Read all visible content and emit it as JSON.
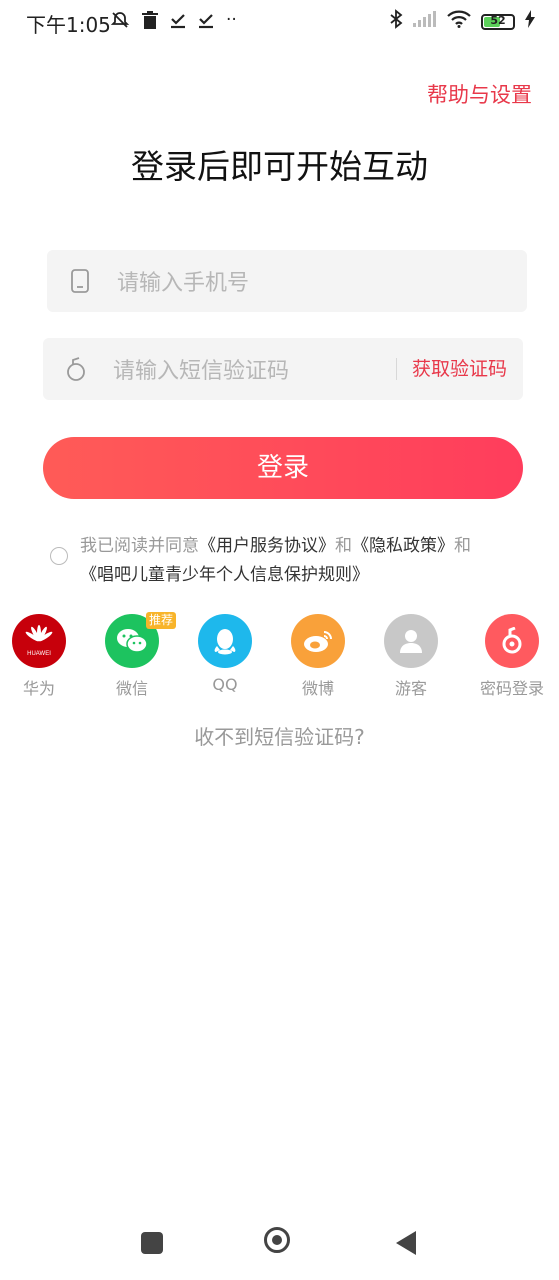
{
  "status_bar": {
    "time": "下午1:05",
    "battery_level": "52",
    "dots": "··"
  },
  "header": {
    "help_settings": "帮助与设置",
    "title": "登录后即可开始互动"
  },
  "form": {
    "phone_placeholder": "请输入手机号",
    "code_placeholder": "请输入短信验证码",
    "get_code": "获取验证码",
    "login": "登录"
  },
  "agreement": {
    "prefix": "我已阅读并同意",
    "terms": "《用户服务协议》",
    "and1": "和",
    "privacy": "《隐私政策》",
    "and2": "和",
    "minors": "《唱吧儿童青少年个人信息保护规则》"
  },
  "socials": {
    "huawei": {
      "label": "华为",
      "logo_text": "HUAWEI",
      "color": "#c7000b"
    },
    "wechat": {
      "label": "微信",
      "badge": "推荐",
      "color": "#1dc35f"
    },
    "qq": {
      "label": "QQ",
      "color": "#1eb8ec"
    },
    "weibo": {
      "label": "微博",
      "color": "#f9a13a"
    },
    "guest": {
      "label": "游客",
      "color": "#c8c8c8"
    },
    "password": {
      "label": "密码登录",
      "color": "#ff5a5f"
    }
  },
  "no_sms": "收不到短信验证码?",
  "colors": {
    "accent": "#e8384a",
    "button_start": "#ff5b57",
    "button_end": "#ff3d5c"
  }
}
